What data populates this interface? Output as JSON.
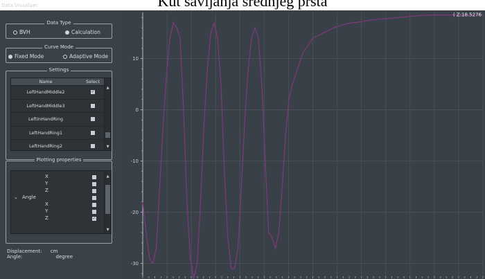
{
  "page_title": "Kut savijanja srednjeg prsta",
  "window": {
    "title": "Data Visualizer"
  },
  "data_type": {
    "legend": "Data Type",
    "options": [
      {
        "label": "BVH",
        "selected": false
      },
      {
        "label": "Calculation",
        "selected": true
      }
    ]
  },
  "curve_mode": {
    "legend": "Curve Mode",
    "options": [
      {
        "label": "Fixed Mode",
        "selected": true
      },
      {
        "label": "Adaptive Mode",
        "selected": false
      }
    ]
  },
  "settings": {
    "legend": "Settings",
    "columns": [
      "Name",
      "Select"
    ],
    "rows": [
      {
        "name": "LeftHandMiddle2",
        "checked": true
      },
      {
        "name": "LeftHandMiddle3",
        "checked": false
      },
      {
        "name": "LeftInHandRing",
        "checked": false
      },
      {
        "name": "LeftHandRing1",
        "checked": false
      },
      {
        "name": "LeftHandRing2",
        "checked": false
      }
    ]
  },
  "plotting": {
    "legend": "Plotting properties",
    "rows": [
      {
        "label": "X",
        "checked": false
      },
      {
        "label": "Y",
        "checked": false
      },
      {
        "label": "Z",
        "checked": false
      },
      {
        "label": "Angle",
        "checked": false,
        "expanded": true
      },
      {
        "label": "X",
        "checked": false
      },
      {
        "label": "Y",
        "checked": false
      },
      {
        "label": "Z",
        "checked": true
      }
    ]
  },
  "units": {
    "displacement_label": "Displacement:",
    "displacement_unit": "cm",
    "angle_label": "Angle:",
    "angle_unit": "degree"
  },
  "chart_data": {
    "type": "line",
    "title": "",
    "xlabel": "",
    "ylabel": "",
    "y_ticks": [
      10,
      0,
      -10,
      -20,
      -30
    ],
    "ylim": [
      -32.5,
      19
    ],
    "xlim": [
      0,
      300
    ],
    "grid": true,
    "cursor_label": "( Z:18.5276",
    "colors": {
      "line": "#7b3a7a",
      "grid": "#4a5058"
    },
    "series": [
      {
        "x": [
          0,
          3,
          6,
          9,
          12,
          15,
          18,
          21,
          24,
          27,
          30,
          33,
          36,
          39,
          42,
          45,
          48,
          51,
          54,
          57,
          60,
          63,
          66,
          69,
          72,
          75,
          78,
          81,
          84,
          87,
          90,
          93,
          96,
          99,
          102,
          105,
          108,
          111,
          114,
          117,
          120,
          123,
          126,
          129,
          132,
          135,
          138,
          141,
          144,
          147,
          150,
          153,
          156,
          159,
          162,
          165,
          168,
          171,
          174,
          177,
          180,
          185,
          190,
          195,
          200,
          205,
          210,
          215,
          220,
          225,
          230,
          235,
          240,
          245,
          250,
          255,
          260,
          265,
          270,
          275,
          280,
          285,
          290,
          295,
          300
        ],
        "values": [
          -18,
          -24,
          -29,
          -30,
          -27,
          -15,
          -3,
          7,
          14,
          17,
          16,
          14,
          0,
          -18,
          -29,
          -33,
          -30,
          -18,
          -3,
          8,
          15,
          17,
          14,
          5,
          -12,
          -25,
          -31,
          -31,
          -27,
          -15,
          -2,
          8,
          14,
          16,
          14,
          5,
          -10,
          -24,
          -25,
          -27,
          -24,
          -15,
          -5,
          2,
          5,
          7,
          9,
          11,
          12,
          13,
          14,
          14.3,
          14.6,
          15,
          15.3,
          15.6,
          16,
          16.2,
          16.4,
          16.6,
          16.8,
          17,
          17.1,
          17.3,
          17.5,
          17.6,
          17.7,
          17.8,
          17.9,
          18,
          18.1,
          18.2,
          18.3,
          18.4,
          18.45,
          18.5,
          18.5,
          18.5,
          18.5,
          18.5,
          18.52,
          18.52,
          18.52,
          18.52,
          18.53
        ]
      }
    ]
  }
}
